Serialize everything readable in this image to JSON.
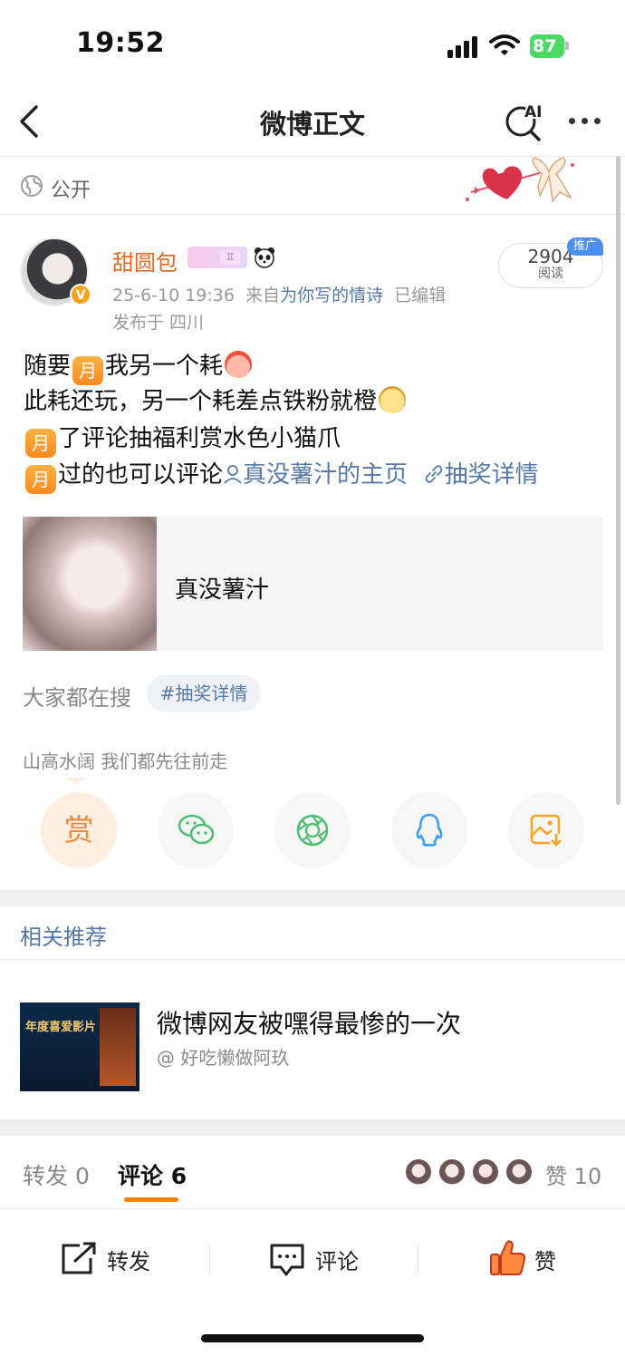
{
  "status_bar": {
    "time": "19:52",
    "battery": "87"
  },
  "nav": {
    "title": "微博正文",
    "ai_label": "AI"
  },
  "visibility": {
    "label": "公开"
  },
  "post": {
    "username": "甜圆包",
    "timestamp": "25-6-10 19:36",
    "source_prefix": "来自",
    "source": "为你写的情诗",
    "edited": "已编辑",
    "location": "发布于 四川",
    "reads_count": "2904",
    "reads_label": "阅读",
    "promo_label": "推广",
    "moon_char": "月",
    "lines": {
      "l1_a": "随要",
      "l1_b": "我另一个耗",
      "l2": "此耗还玩，另一个耗差点铁粉就橙",
      "l3": "了评论抽福利赏水色小猫爪",
      "l4": "过的也可以评论",
      "l4_link1": "真没薯汁的主页",
      "l4_link2": "抽奖详情"
    },
    "card_title": "真没薯汁"
  },
  "search": {
    "label": "大家都在搜",
    "tag": "#抽奖详情"
  },
  "motto": "山高水阔 我们都先往前走",
  "reward_label": "赏",
  "related": {
    "section_title": "相关推荐",
    "thumb_caption": "年度喜爱影片",
    "title": "微博网友被嘿得最惨的一次",
    "author": "@ 好吃懒做阿玖"
  },
  "tabs": {
    "repost_label": "转发",
    "repost_count": "0",
    "comment_label": "评论",
    "comment_count": "6",
    "like_label": "赞",
    "like_count": "10"
  },
  "actions": {
    "repost": "转发",
    "comment": "评论",
    "like": "赞"
  },
  "colors": {
    "accent": "#ff8200",
    "link": "#5578a8",
    "username": "#e8691d"
  }
}
